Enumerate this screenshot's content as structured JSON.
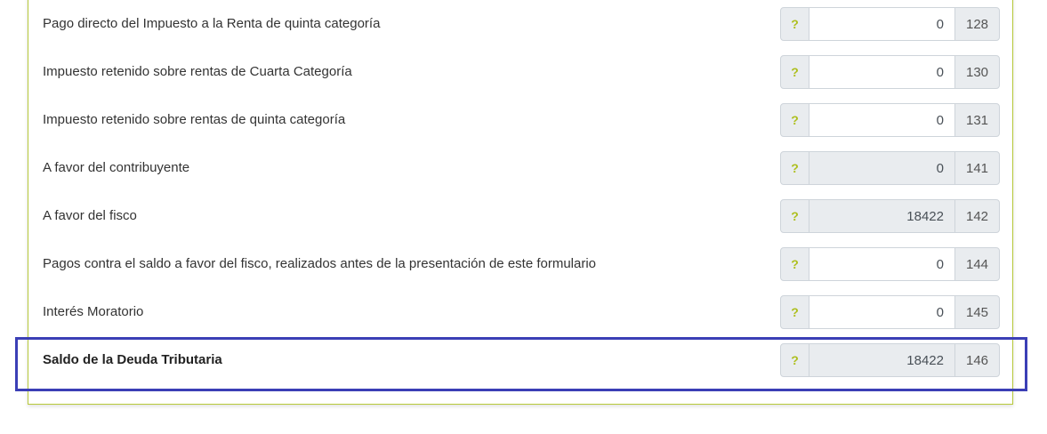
{
  "rows": [
    {
      "label": "Pago directo del Impuesto a la Renta de quinta categoría",
      "help": "?",
      "value": "0",
      "code": "128",
      "readonly": false
    },
    {
      "label": "Impuesto retenido sobre rentas de Cuarta Categoría",
      "help": "?",
      "value": "0",
      "code": "130",
      "readonly": false
    },
    {
      "label": "Impuesto retenido sobre rentas de quinta categoría",
      "help": "?",
      "value": "0",
      "code": "131",
      "readonly": false
    },
    {
      "label": "A favor del contribuyente",
      "help": "?",
      "value": "0",
      "code": "141",
      "readonly": true
    },
    {
      "label": "A favor del fisco",
      "help": "?",
      "value": "18422",
      "code": "142",
      "readonly": true
    },
    {
      "label": "Pagos contra el saldo a favor del fisco, realizados antes de la presentación de este formulario",
      "help": "?",
      "value": "0",
      "code": "144",
      "readonly": false
    },
    {
      "label": "Interés Moratorio",
      "help": "?",
      "value": "0",
      "code": "145",
      "readonly": false
    },
    {
      "label": "Saldo de la Deuda Tributaria",
      "help": "?",
      "value": "18422",
      "code": "146",
      "readonly": true
    }
  ],
  "colors": {
    "accent": "#aebf1e",
    "panel_border": "#b7c93a",
    "highlight": "#3b3fb6",
    "readonly_bg": "#e9ecef"
  }
}
